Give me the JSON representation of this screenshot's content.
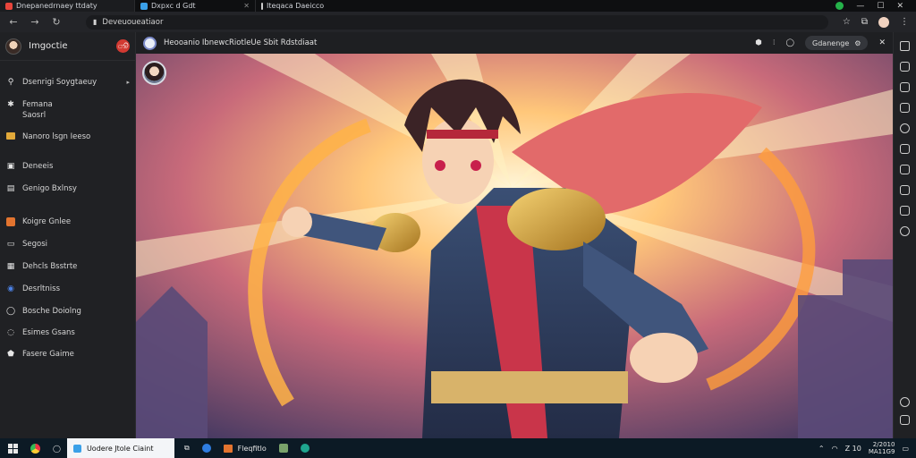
{
  "tabs": [
    {
      "label": "Dnepanedrnaey ttdaty",
      "color": "#e8453c"
    },
    {
      "label": "Dxpxc d Gdt",
      "color": "#3aa0e8"
    },
    {
      "label": "Iteqaca Daeicco",
      "color": "#cccccc"
    }
  ],
  "address": {
    "url": "Deveuoueatiaor"
  },
  "sidebar": {
    "title": "Imgoctie",
    "badge": "ூ",
    "items": [
      {
        "label": "Dsenrigi Soygtaeuy",
        "icon": "search-icon",
        "chevron": "▸"
      },
      {
        "label": "Femana\nSaosrl",
        "icon": "star-icon"
      },
      {
        "label": "Nanoro lsgn Ieeso",
        "icon": "folder-icon"
      },
      {
        "label": "Deneeis",
        "icon": "doc-icon"
      },
      {
        "label": "Genigo Bxlnsy",
        "icon": "bookmark-icon"
      },
      {
        "label": "Koigre Gnlee",
        "icon": "image-icon"
      },
      {
        "label": "Segosi",
        "icon": "page-icon"
      },
      {
        "label": "Dehcls Bsstrte",
        "icon": "gallery-icon"
      },
      {
        "label": "Desrltniss",
        "icon": "globe-icon"
      },
      {
        "label": "Bosche Doiolng",
        "icon": "chat-icon"
      },
      {
        "label": "Esimes Gsans",
        "icon": "sync-icon"
      },
      {
        "label": "Fasere Gaime",
        "icon": "shield-icon"
      }
    ]
  },
  "content": {
    "title": "Heooanio IbnewcRiotleUe Sbit Rdstdiaat",
    "pill": "Gdanenge"
  },
  "taskbar": {
    "active_app": "Uodere Jtole Ciaint",
    "app2": "Fleqfitlo",
    "time": "Z 10",
    "date": "2/2010\nMA11G9"
  }
}
